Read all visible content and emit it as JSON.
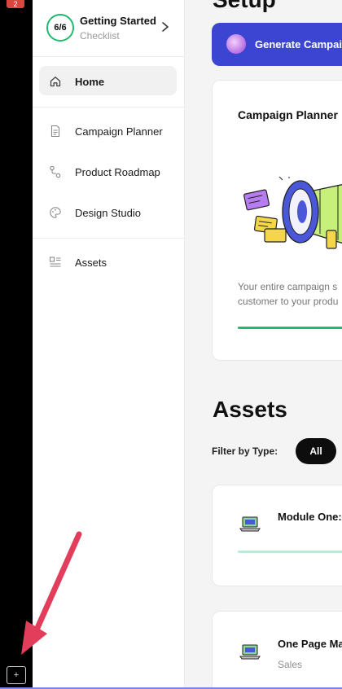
{
  "rail": {
    "badge": "2",
    "add_button": "+"
  },
  "sidebar": {
    "checklist": {
      "progress": "6/6",
      "title": "Getting Started",
      "subtitle": "Checklist"
    },
    "home": "Home",
    "items": [
      "Campaign Planner",
      "Product Roadmap",
      "Design Studio"
    ],
    "assets": "Assets"
  },
  "main": {
    "setup_title": "Setup",
    "generate_button": "Generate Campaign",
    "planner_card": {
      "title": "Campaign Planner",
      "description_lines": [
        "Your entire campaign s",
        "customer to your produ"
      ]
    },
    "assets_title": "Assets",
    "filter_label": "Filter by Type:",
    "filter_all": "All",
    "asset_cards": [
      {
        "name": "Module One:",
        "category": ""
      },
      {
        "name": "One Page Ma",
        "category": "Sales"
      }
    ]
  },
  "colors": {
    "accent_blue": "#3c45d1",
    "success_green": "#1fba6d",
    "annotation_red": "#e23d5a"
  }
}
